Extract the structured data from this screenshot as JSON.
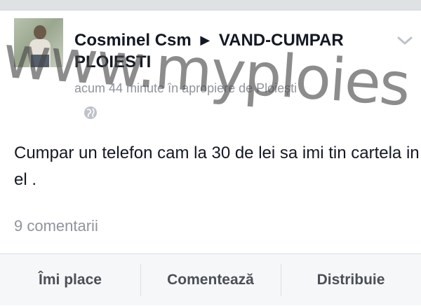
{
  "post": {
    "author": "Cosminel Csm",
    "group_line1": "VAND-CUMPAR",
    "group_line2": "PLOIESTI",
    "meta": "acum 44 minute în apropiere de Ploiești",
    "text": "Cumpar un telefon cam la 30 de lei sa imi tin cartela in el .",
    "comments": "9 comentarii"
  },
  "actions": {
    "like": "Îmi place",
    "comment": "Comentează",
    "share": "Distribuie"
  },
  "watermark": "www.myploies",
  "icons": {
    "arrow": "right-arrow-icon",
    "chevron": "chevron-down-icon",
    "globe": "globe-icon"
  }
}
